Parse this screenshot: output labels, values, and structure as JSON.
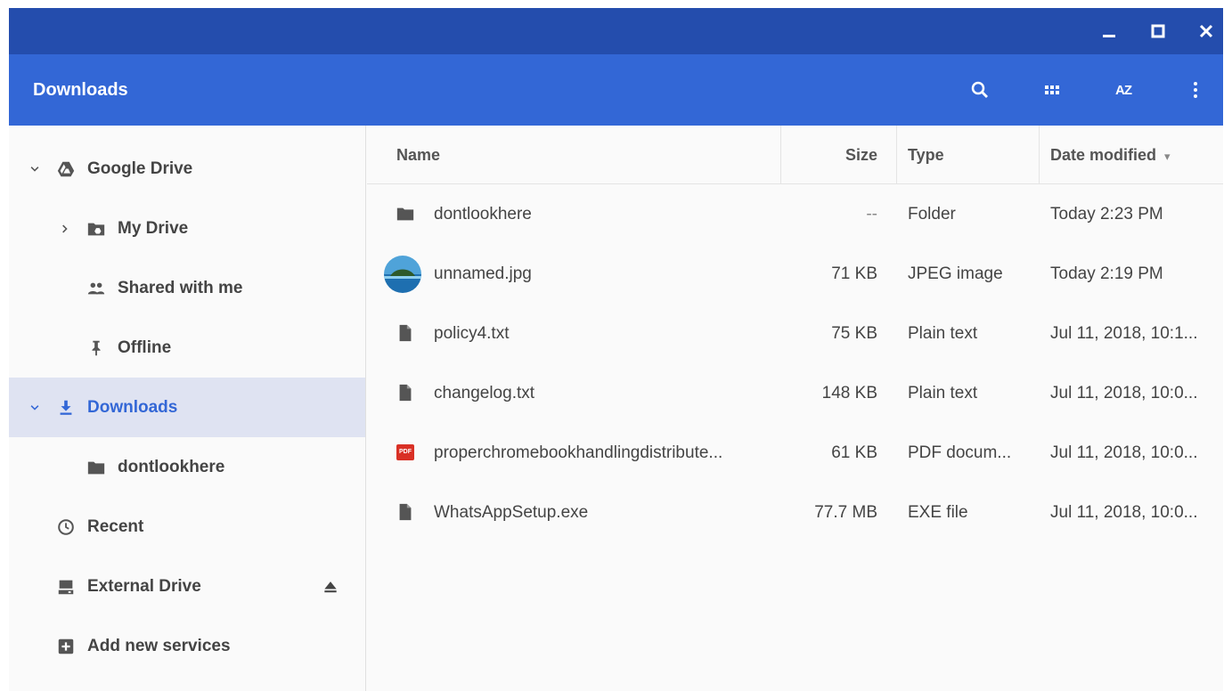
{
  "window": {
    "controls": [
      "minimize-icon",
      "maximize-icon",
      "close-icon"
    ]
  },
  "toolbar": {
    "title": "Downloads",
    "actions": [
      "search-icon",
      "grid-view-icon",
      "sort-az-icon",
      "more-vert-icon"
    ],
    "sort_label": "AZ"
  },
  "sidebar": {
    "google_drive": "Google Drive",
    "my_drive": "My Drive",
    "shared_with_me": "Shared with me",
    "offline": "Offline",
    "downloads": "Downloads",
    "dontlookhere": "dontlookhere",
    "recent": "Recent",
    "external_drive": "External Drive",
    "add_new_services": "Add new services"
  },
  "columns": {
    "name": "Name",
    "size": "Size",
    "type": "Type",
    "date": "Date modified",
    "sort_indicator": "▾"
  },
  "files": [
    {
      "name": "dontlookhere",
      "size": "--",
      "type": "Folder",
      "date": "Today 2:23 PM",
      "icon": "folder-icon"
    },
    {
      "name": "unnamed.jpg",
      "size": "71 KB",
      "type": "JPEG image",
      "date": "Today 2:19 PM",
      "icon": "image-thumbnail"
    },
    {
      "name": "policy4.txt",
      "size": "75 KB",
      "type": "Plain text",
      "date": "Jul 11, 2018, 10:1...",
      "icon": "file-icon"
    },
    {
      "name": "changelog.txt",
      "size": "148 KB",
      "type": "Plain text",
      "date": "Jul 11, 2018, 10:0...",
      "icon": "file-icon"
    },
    {
      "name": "properchromebookhandlingdistribute...",
      "size": "61 KB",
      "type": "PDF docum...",
      "date": "Jul 11, 2018, 10:0...",
      "icon": "pdf-icon"
    },
    {
      "name": "WhatsAppSetup.exe",
      "size": "77.7 MB",
      "type": "EXE file",
      "date": "Jul 11, 2018, 10:0...",
      "icon": "file-icon"
    }
  ],
  "pdf_badge": "PDF",
  "colors": {
    "titlebar": "#244dad",
    "toolbar": "#3367d6",
    "active_nav_bg": "#dfe3f2",
    "pdf_red": "#d93025"
  }
}
